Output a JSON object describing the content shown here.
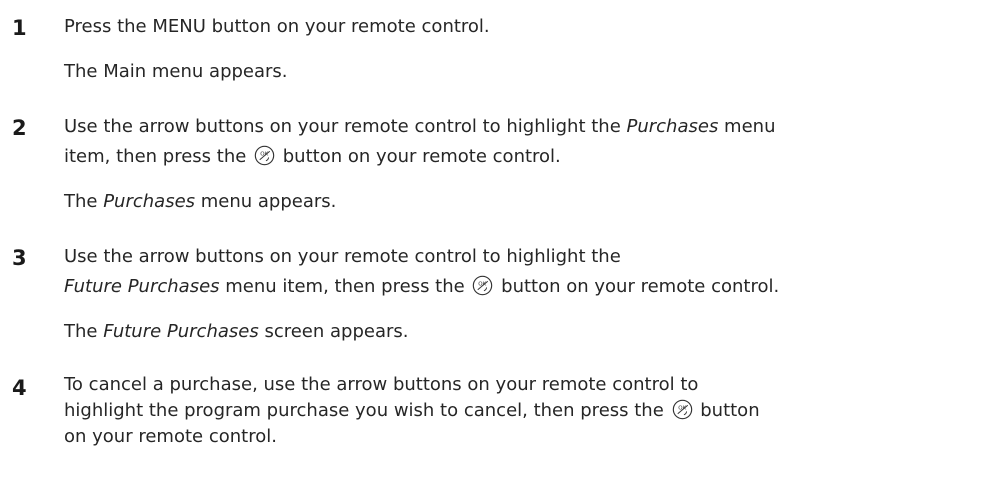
{
  "steps": [
    {
      "number": "1",
      "text": "Press the MENU button on your remote control.",
      "result": "The Main menu appears."
    },
    {
      "number": "2",
      "line1_a": "Use the arrow buttons on your remote control to highlight the ",
      "line1_em": "Purchases",
      "line1_b": " menu",
      "line2_a": "item, then press the ",
      "line2_b": " button on your remote control.",
      "result_em": "Purchases",
      "result_b": " menu appears."
    },
    {
      "number": "3",
      "line1": "Use the arrow buttons on your remote control to highlight the",
      "line2_em": "Future Purchases",
      "line2_a": " menu item, then press the ",
      "line2_b": " button on your remote control.",
      "result_a": "The ",
      "result_em": "Future Purchases",
      "result_b": " screen appears."
    },
    {
      "number": "4",
      "line1": "To cancel a purchase, use the arrow buttons on your remote control to",
      "line2_a": "highlight the program purchase you wish to cancel, then press the ",
      "line2_b": " button",
      "line3": "on your remote control."
    }
  ],
  "result_prefix": "The ",
  "icons": {
    "ok_button": "ok-button-icon"
  }
}
